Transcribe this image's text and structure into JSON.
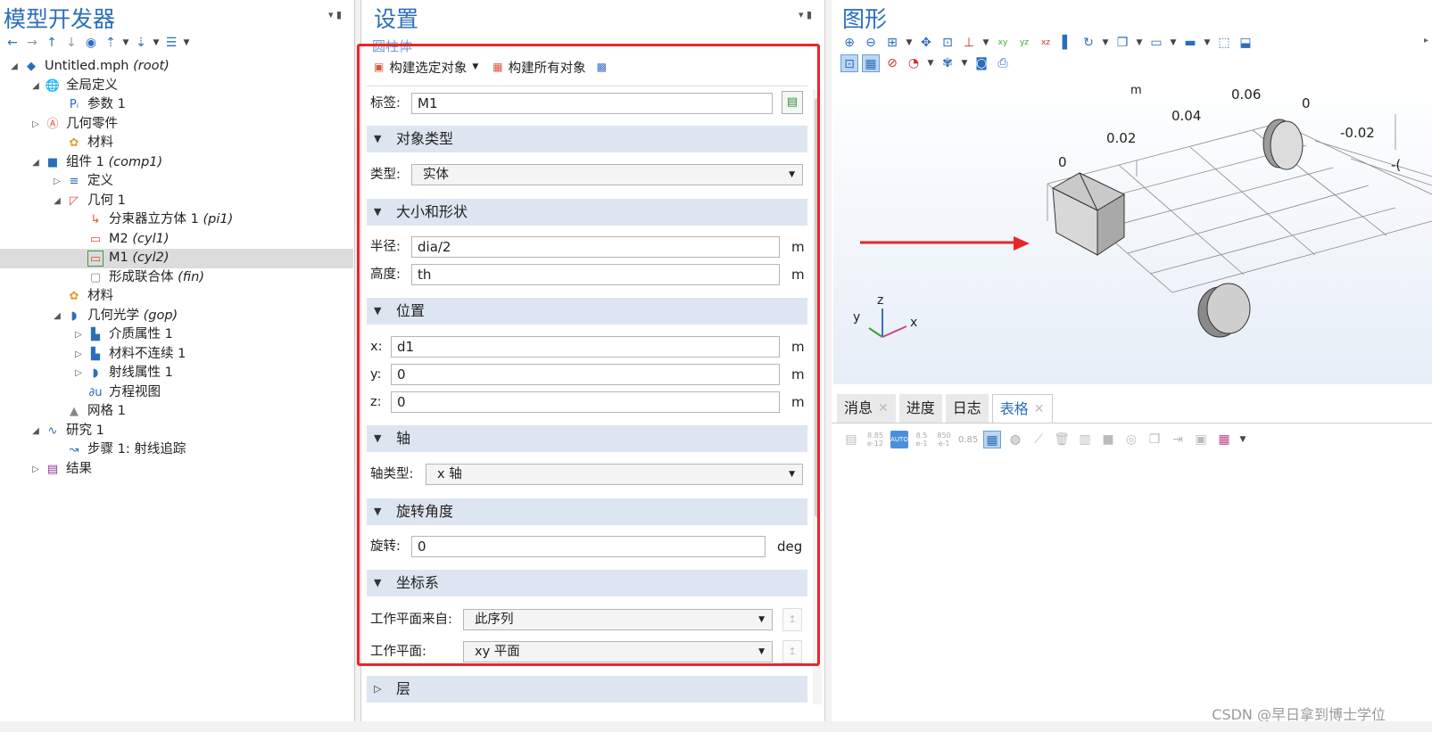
{
  "left": {
    "title": "模型开发器",
    "toolbar": [
      "←",
      "→",
      "↑",
      "↓",
      "◉",
      "⇡",
      "⇣",
      "☰"
    ],
    "tree": [
      {
        "name": "Untitled.mph",
        "em": "(root)",
        "icon": "◆",
        "tw": "◢"
      },
      {
        "name": "全局定义",
        "em": "",
        "icon": "🌐",
        "tw": "◢"
      },
      {
        "name": "参数 1",
        "em": "",
        "icon": "Pᵢ",
        "tw": ""
      },
      {
        "name": "几何零件",
        "em": "",
        "icon": "Ⓐ",
        "tw": "▷"
      },
      {
        "name": "材料",
        "em": "",
        "icon": "✿",
        "tw": ""
      },
      {
        "name": "组件 1",
        "em": "(comp1)",
        "icon": "■",
        "tw": "◢"
      },
      {
        "name": "定义",
        "em": "",
        "icon": "≡",
        "tw": "▷"
      },
      {
        "name": "几何 1",
        "em": "",
        "icon": "◸",
        "tw": "◢"
      },
      {
        "name": "分束器立方体 1",
        "em": "(pi1)",
        "icon": "↳",
        "tw": ""
      },
      {
        "name": "M2",
        "em": "(cyl1)",
        "icon": "▭",
        "tw": ""
      },
      {
        "name": "M1",
        "em": "(cyl2)",
        "icon": "▭",
        "tw": ""
      },
      {
        "name": "形成联合体",
        "em": "(fin)",
        "icon": "▢",
        "tw": ""
      },
      {
        "name": "材料",
        "em": "",
        "icon": "✿",
        "tw": ""
      },
      {
        "name": "几何光学",
        "em": "(gop)",
        "icon": "◗",
        "tw": "◢"
      },
      {
        "name": "介质属性 1",
        "em": "",
        "icon": "▙",
        "tw": "▷"
      },
      {
        "name": "材料不连续 1",
        "em": "",
        "icon": "▙",
        "tw": "▷"
      },
      {
        "name": "射线属性 1",
        "em": "",
        "icon": "◗",
        "tw": "▷"
      },
      {
        "name": "方程视图",
        "em": "",
        "icon": "∂u",
        "tw": ""
      },
      {
        "name": "网格 1",
        "em": "",
        "icon": "▲",
        "tw": ""
      },
      {
        "name": "研究 1",
        "em": "",
        "icon": "∿",
        "tw": "◢"
      },
      {
        "name": "步骤 1: 射线追踪",
        "em": "",
        "icon": "↝",
        "tw": ""
      },
      {
        "name": "结果",
        "em": "",
        "icon": "▤",
        "tw": "▷"
      }
    ]
  },
  "mid": {
    "title": "设置",
    "subtitle": "圆柱体",
    "build_selected": "构建选定对象",
    "build_all": "构建所有对象",
    "label_label": "标签:",
    "label_value": "M1",
    "sec_object_type": "对象类型",
    "type_label": "类型:",
    "type_value": "实体",
    "sec_size": "大小和形状",
    "radius_label": "半径:",
    "radius_value": "dia/2",
    "height_label": "高度:",
    "height_value": "th",
    "unit_m": "m",
    "sec_position": "位置",
    "x_label": "x:",
    "x_value": "d1",
    "y_label": "y:",
    "y_value": "0",
    "z_label": "z:",
    "z_value": "0",
    "sec_axis": "轴",
    "axis_type_label": "轴类型:",
    "axis_type_value": "x 轴",
    "sec_rotation": "旋转角度",
    "rotation_label": "旋转:",
    "rotation_value": "0",
    "unit_deg": "deg",
    "sec_coord": "坐标系",
    "wp_from_label": "工作平面来自:",
    "wp_from_value": "此序列",
    "wp_label": "工作平面:",
    "wp_value": "xy 平面",
    "sec_layers": "层"
  },
  "right": {
    "title": "图形",
    "axis_labels": {
      "m": "m",
      "t006": "0.06",
      "t004": "0.04",
      "t002": "0.02",
      "t0a": "0",
      "t0b": "0",
      "tneg002": "-0.02",
      "tneg": "-("
    },
    "triad": {
      "z": "z",
      "y": "y",
      "x": "x"
    },
    "tabs": [
      "消息",
      "进度",
      "日志",
      "表格"
    ],
    "table_tools": [
      "8.85 e-12",
      "8.5 e-1",
      "850 e-1",
      "0.85"
    ]
  },
  "watermark": "CSDN @早日拿到博士学位"
}
